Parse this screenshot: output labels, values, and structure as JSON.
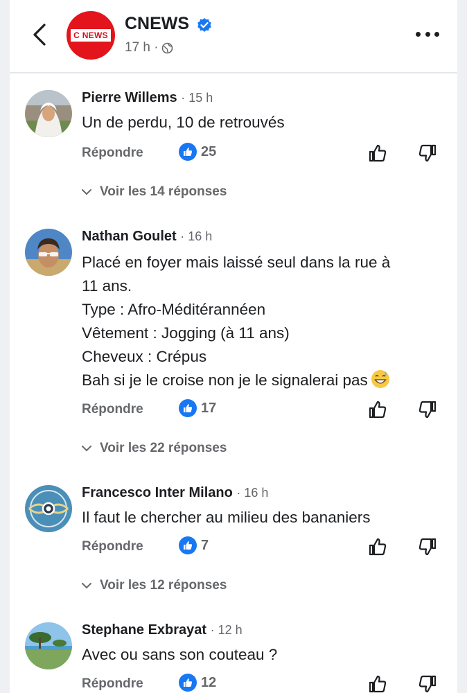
{
  "header": {
    "page_name": "CNEWS",
    "logo_text": "C NEWS",
    "post_time": "17 h ·",
    "icons": {
      "back": "back-arrow-icon",
      "verified": "verified-badge-icon",
      "privacy": "globe-icon",
      "more": "more-options-icon"
    }
  },
  "colors": {
    "accent": "#1877f2",
    "brand": "#e3141c",
    "muted": "#65676b"
  },
  "comments": [
    {
      "author": "Pierre Willems",
      "time": "· 15 h",
      "lines": [
        "Un de perdu, 10 de retrouvés"
      ],
      "reply_label": "Répondre",
      "like_count": "25",
      "view_replies": "Voir les 14 réponses"
    },
    {
      "author": "Nathan Goulet",
      "time": "· 16 h",
      "lines": [
        "Placé en foyer mais laissé seul dans la rue à",
        "11 ans.",
        "Type : Afro-Méditérannéen",
        "Vêtement : Jogging (à 11 ans)",
        "Cheveux : Crépus",
        "Bah si je le croise non je le signalerai pas"
      ],
      "emoji": "grinning-sweat-emoji",
      "reply_label": "Répondre",
      "like_count": "17",
      "view_replies": "Voir les 22 réponses"
    },
    {
      "author": "Francesco Inter Milano",
      "time": "· 16 h",
      "lines": [
        "Il faut le chercher au milieu des bananiers"
      ],
      "reply_label": "Répondre",
      "like_count": "7",
      "view_replies": "Voir les 12 réponses"
    },
    {
      "author": "Stephane Exbrayat",
      "time": "· 12 h",
      "lines": [
        "Avec ou sans son couteau ?"
      ],
      "reply_label": "Répondre",
      "like_count": "12"
    }
  ]
}
